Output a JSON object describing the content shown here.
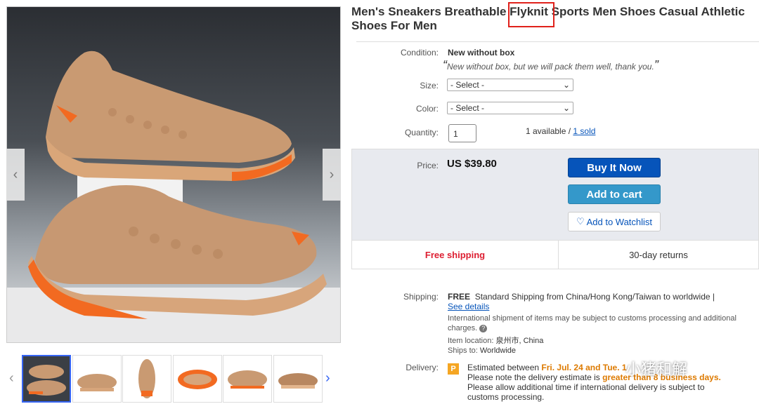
{
  "title": "Men's Sneakers Breathable Flyknit Sports Men Shoes Casual Athletic Shoes For Men",
  "gallery": {
    "prev_arrow": "‹",
    "next_arrow": "›",
    "thumbs": [
      "thumb-1",
      "thumb-2",
      "thumb-3",
      "thumb-4",
      "thumb-5",
      "thumb-6"
    ],
    "thumb_prev": "‹",
    "thumb_next": "›"
  },
  "condition": {
    "label": "Condition:",
    "value": "New without box",
    "note": "New without box, but we will pack them well, thank you."
  },
  "size": {
    "label": "Size:",
    "placeholder": "- Select -"
  },
  "color": {
    "label": "Color:",
    "placeholder": "- Select -"
  },
  "quantity": {
    "label": "Quantity:",
    "value": "1",
    "available": "1 available /",
    "sold": "1 sold"
  },
  "price": {
    "label": "Price:",
    "value": "US $39.80"
  },
  "buttons": {
    "buy": "Buy It Now",
    "cart": "Add to cart",
    "watch": "Add to Watchlist"
  },
  "badges": {
    "shipping": "Free shipping",
    "returns": "30-day returns"
  },
  "shipping": {
    "label": "Shipping:",
    "free": "FREE",
    "desc": "Standard Shipping from China/Hong Kong/Taiwan to worldwide |",
    "details_link": "See details",
    "intl_note": "International shipment of items may be subject to customs processing and additional charges.",
    "help_icon": "?",
    "location_label": "Item location:",
    "location_value": "泉州市, China",
    "ships_label": "Ships to:",
    "ships_value": "Worldwide"
  },
  "delivery": {
    "label": "Delivery:",
    "est_prefix": "Estimated between",
    "est_dates": "Fri. Jul. 24 and Tue.",
    "est_tail": "1",
    "line2_prefix": "Please note the delivery estimate is",
    "line2_bold": "greater than 8 business days.",
    "line3": "Please allow additional time if international delivery is subject to",
    "line4": "customs processing."
  },
  "watermark": "小猪和解",
  "colors": {
    "accent_blue": "#0654ba",
    "cart_blue": "#3498ca",
    "free_red": "#dd1e31",
    "highlight_box": "#e0211b"
  }
}
